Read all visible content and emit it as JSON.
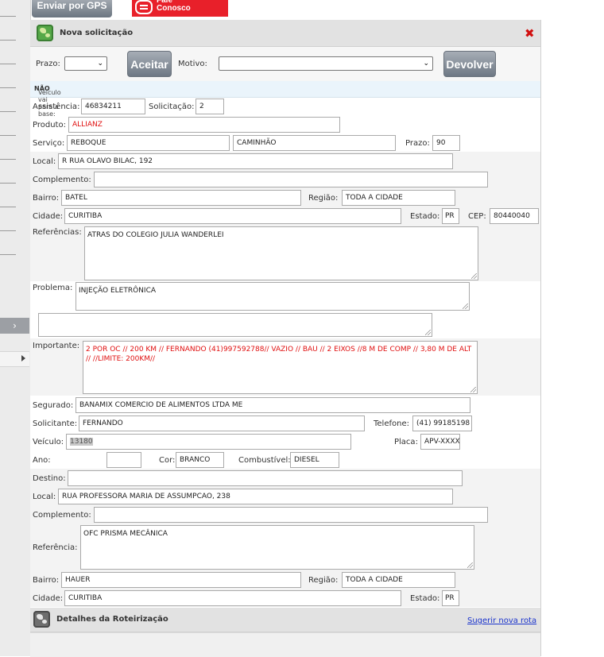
{
  "top_buttons": {
    "gps_label": "Enviar por GPS",
    "fale_label": "Fale\nConosco"
  },
  "panel": {
    "title": "Nova solicitação"
  },
  "toolbar": {
    "prazo_label": "Prazo:",
    "prazo_value": "",
    "aceitar_label": "Aceitar",
    "motivo_label": "Motivo:",
    "motivo_value": "",
    "devolver_label": "Devolver"
  },
  "info": {
    "text": "Veículo vai para a base:",
    "value": "NÃO"
  },
  "form": {
    "assistencia": {
      "label": "Assistência:",
      "value": "46834211"
    },
    "solicitacao": {
      "label": "Solicitação:",
      "value": "2"
    },
    "produto": {
      "label": "Produto:",
      "value": "ALLIANZ"
    },
    "servico": {
      "label": "Serviço:",
      "value": "REBOQUE",
      "value2": "CAMINHÃO"
    },
    "prazo": {
      "label": "Prazo:",
      "value": "90"
    },
    "local": {
      "label": "Local:",
      "value": "R RUA OLAVO BILAC, 192"
    },
    "complemento": {
      "label": "Complemento:",
      "value": ""
    },
    "bairro": {
      "label": "Bairro:",
      "value": "BATEL"
    },
    "regiao": {
      "label": "Região:",
      "value": "TODA A CIDADE"
    },
    "cidade": {
      "label": "Cidade:",
      "value": "CURITIBA"
    },
    "estado": {
      "label": "Estado:",
      "value": "PR"
    },
    "cep": {
      "label": "CEP:",
      "value": "80440040"
    },
    "referencias": {
      "label": "Referências:",
      "value": "ATRAS DO COLEGIO JULIA WANDERLEI"
    },
    "problema": {
      "label": "Problema:",
      "value": "INJEÇÃO ELETRÔNICA",
      "extra": ""
    },
    "importante": {
      "label": "Importante:",
      "value": "2 POR OC // 200 KM // FERNANDO (41)997592788// VAZIO // BAU // 2 EIXOS  //8 M DE COMP // 3,80 M DE ALT //  //LIMITE: 200KM//"
    },
    "segurado": {
      "label": "Segurado:",
      "value": "BANAMIX COMERCIO DE ALIMENTOS LTDA ME"
    },
    "solicitante": {
      "label": "Solicitante:",
      "value": "FERNANDO"
    },
    "telefone": {
      "label": "Telefone:",
      "value": "(41) 99185198"
    },
    "veiculo": {
      "label": "Veículo:",
      "value": "13180"
    },
    "placa": {
      "label": "Placa:",
      "value": "APV-XXXX"
    },
    "ano": {
      "label": "Ano:",
      "value": ""
    },
    "cor": {
      "label": "Cor:",
      "value": "BRANCO"
    },
    "combustivel": {
      "label": "Combustível:",
      "value": "DIESEL"
    }
  },
  "destino": {
    "destino": {
      "label": "Destino:",
      "value": ""
    },
    "local": {
      "label": "Local:",
      "value": "RUA PROFESSORA MARIA DE ASSUMPCAO, 238"
    },
    "complemento": {
      "label": "Complemento:",
      "value": ""
    },
    "referencia": {
      "label": "Referência:",
      "value": "OFC PRISMA MECÂNICA"
    },
    "bairro": {
      "label": "Bairro:",
      "value": "HAUER"
    },
    "regiao": {
      "label": "Região:",
      "value": "TODA A CIDADE"
    },
    "cidade": {
      "label": "Cidade:",
      "value": "CURITIBA"
    },
    "estado": {
      "label": "Estado:",
      "value": "PR"
    }
  },
  "route": {
    "title": "Detalhes da Roteirização",
    "link": "Sugerir nova rota"
  },
  "colors": {
    "accent_red": "#e8202a",
    "header_gray": "#e2e2e2",
    "link_blue": "#1a33cc"
  }
}
